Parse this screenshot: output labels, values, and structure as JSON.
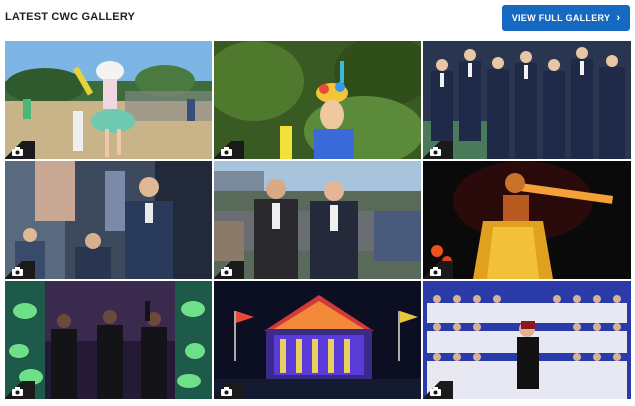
{
  "header": {
    "title": "LATEST CWC GALLERY",
    "view_all_label": "VIEW FULL GALLERY"
  },
  "icons": {
    "camera": "camera-icon",
    "chevron": "chevron-right-icon"
  },
  "colors": {
    "accent": "#1569c0",
    "title_text": "#222222",
    "badge": "#1a1a1a"
  },
  "gallery": {
    "photo_count": 9
  }
}
